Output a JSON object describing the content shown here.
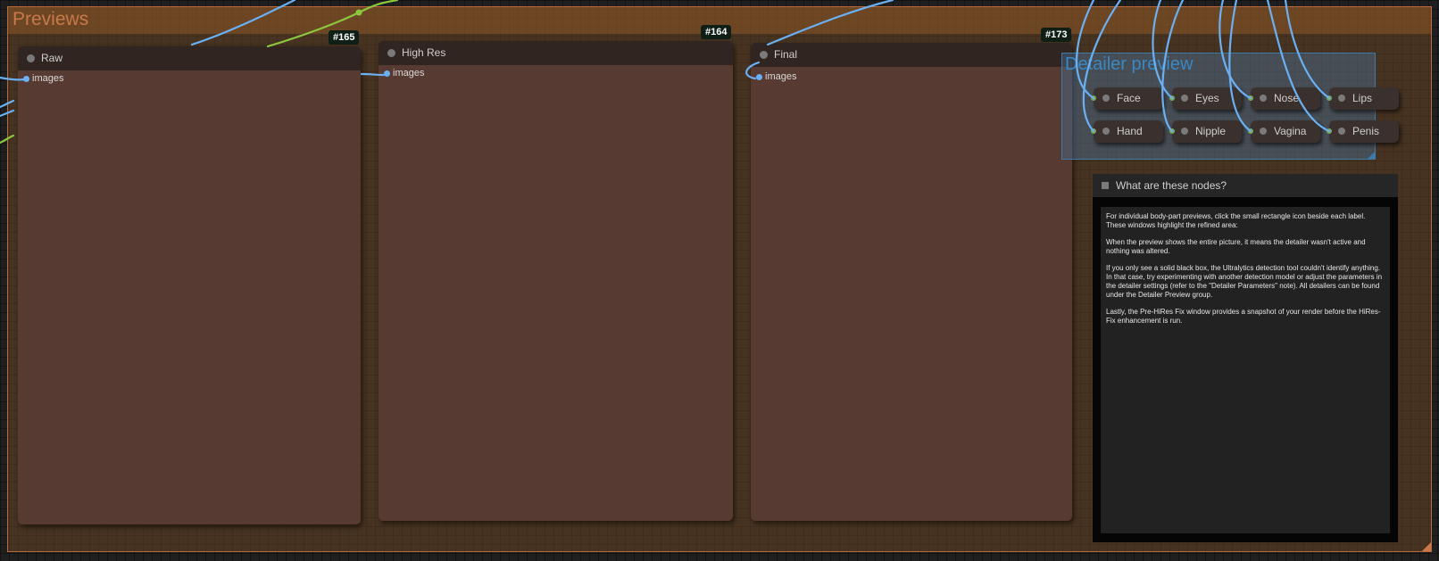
{
  "group": {
    "title": "Previews"
  },
  "nodes": {
    "raw": {
      "title": "Raw",
      "input": "images",
      "badge": "#165"
    },
    "high_res": {
      "title": "High Res",
      "input": "images",
      "badge": "#164"
    },
    "final": {
      "title": "Final",
      "input": "images",
      "badge": "#173"
    }
  },
  "detailer": {
    "title": "Detailer preview",
    "items": [
      "Face",
      "Eyes",
      "Nose",
      "Lips",
      "Hand",
      "Nipple",
      "Vagina",
      "Penis"
    ]
  },
  "note": {
    "title": "What are these nodes?",
    "paragraphs": [
      "For individual body-part previews, click the small rectangle icon beside each label. These windows highlight the refined area:",
      "When the preview shows the entire picture, it means the detailer wasn't active and nothing was altered.",
      "If you only see a solid black box, the Ultralytics detection tool couldn't identify anything. In that case, try experimenting with another detection model or adjust the parameters in the detailer settings (refer to the \"Detailer Parameters\" note). All detailers can be found under the Detailer Preview group.",
      "Lastly, the Pre-HiRes Fix window provides a snapshot of your render before the HiRes-Fix enhancement is run."
    ]
  },
  "colors": {
    "wire_image": "#6ab0f3",
    "wire_latent": "#8dc63f",
    "group_accent": "#c9794a",
    "detailer_accent": "#3a88c4"
  }
}
